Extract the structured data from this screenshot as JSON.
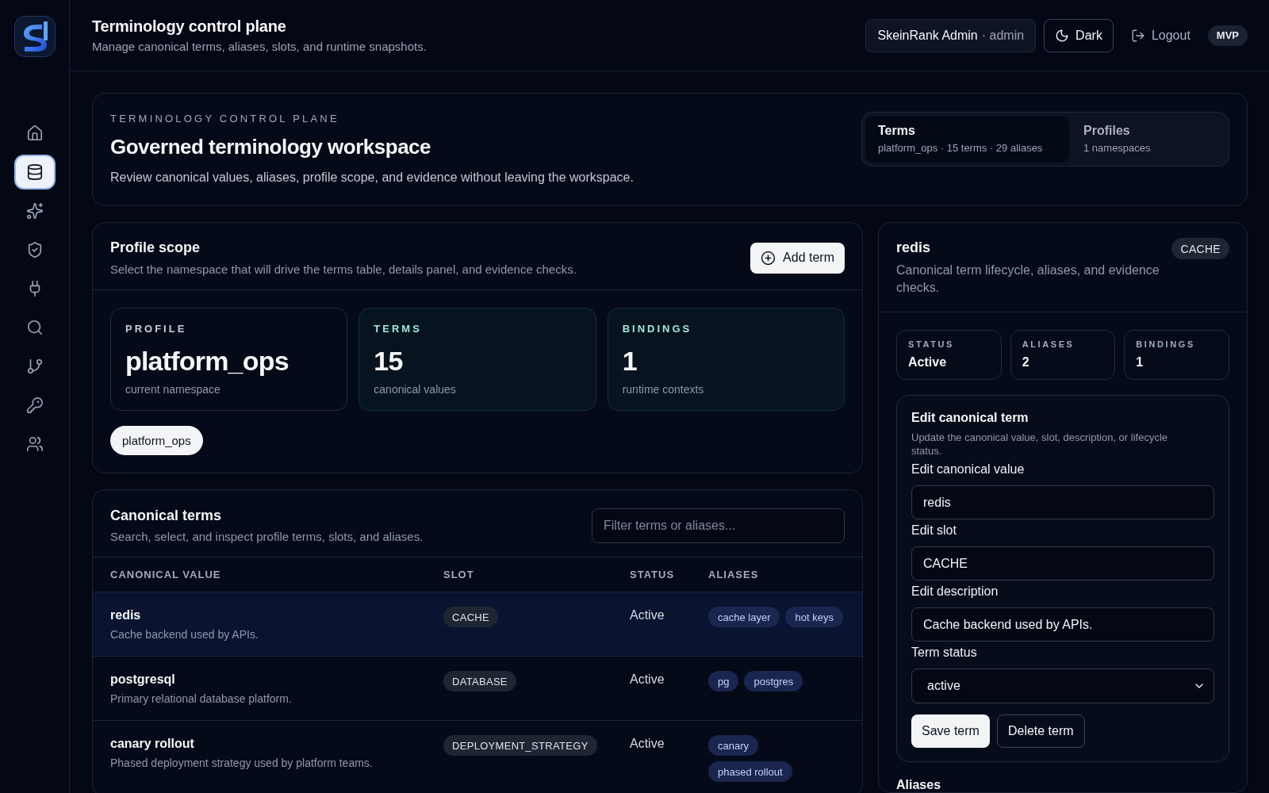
{
  "sidebar": {
    "nav": [
      {
        "kind": "home",
        "selected": false
      },
      {
        "kind": "database",
        "selected": true
      },
      {
        "kind": "sparkles",
        "selected": false
      },
      {
        "kind": "shield",
        "selected": false
      },
      {
        "kind": "plug",
        "selected": false
      },
      {
        "kind": "search",
        "selected": false
      },
      {
        "kind": "branch",
        "selected": false
      },
      {
        "kind": "key",
        "selected": false
      },
      {
        "kind": "users",
        "selected": false
      }
    ]
  },
  "header": {
    "title": "Terminology control plane",
    "subtitle": "Manage canonical terms, aliases, slots, and runtime snapshots.",
    "user": {
      "name": "SkeinRank Admin",
      "role": "· admin"
    },
    "theme_button": "Dark",
    "logout_button": "Logout",
    "badge": "MVP"
  },
  "hero": {
    "eyebrow": "TERMINOLOGY CONTROL PLANE",
    "title": "Governed terminology workspace",
    "description": "Review canonical values, aliases, profile scope, and evidence without leaving the workspace.",
    "tabs": [
      {
        "label": "Terms",
        "detail": "platform_ops · 15 terms · 29 aliases",
        "selected": true
      },
      {
        "label": "Profiles",
        "detail": "1 namespaces",
        "selected": false
      }
    ]
  },
  "profile_scope": {
    "title": "Profile scope",
    "description": "Select the namespace that will drive the terms table, details panel, and evidence checks.",
    "add_button": "Add term",
    "stats": [
      {
        "label": "PROFILE",
        "value": "platform_ops",
        "caption": "current namespace",
        "highlighted": false
      },
      {
        "label": "TERMS",
        "value": "15",
        "caption": "canonical values",
        "highlighted": true
      },
      {
        "label": "BINDINGS",
        "value": "1",
        "caption": "runtime contexts",
        "highlighted": true
      }
    ],
    "profiles": [
      {
        "label": "platform_ops",
        "selected": true
      }
    ]
  },
  "terms_table": {
    "title": "Canonical terms",
    "description": "Search, select, and inspect profile terms, slots, and aliases.",
    "filter": {
      "placeholder": "Filter terms or aliases..."
    },
    "columns": [
      "CANONICAL VALUE",
      "SLOT",
      "STATUS",
      "ALIASES"
    ],
    "rows": [
      {
        "value": "redis",
        "description": "Cache backend used by APIs.",
        "slot": "CACHE",
        "status": "Active",
        "aliases": [
          "cache layer",
          "hot keys"
        ],
        "selected": true
      },
      {
        "value": "postgresql",
        "description": "Primary relational database platform.",
        "slot": "DATABASE",
        "status": "Active",
        "aliases": [
          "pg",
          "postgres"
        ],
        "selected": false
      },
      {
        "value": "canary rollout",
        "description": "Phased deployment strategy used by platform teams.",
        "slot": "DEPLOYMENT_STRATEGY",
        "status": "Active",
        "aliases": [
          "canary",
          "phased rollout"
        ],
        "selected": false
      }
    ]
  },
  "term_detail": {
    "title": "redis",
    "slot": "CACHE",
    "description": "Canonical term lifecycle, aliases, and evidence checks.",
    "stats": [
      {
        "label": "STATUS",
        "value": "Active"
      },
      {
        "label": "ALIASES",
        "value": "2"
      },
      {
        "label": "BINDINGS",
        "value": "1"
      }
    ],
    "edit_form": {
      "title": "Edit canonical term",
      "description": "Update the canonical value, slot, description, or lifecycle status.",
      "fields": [
        {
          "kind": "text",
          "label": "Edit canonical value",
          "value": "redis"
        },
        {
          "kind": "text",
          "label": "Edit slot",
          "value": "CACHE"
        },
        {
          "kind": "text",
          "label": "Edit description",
          "value": "Cache backend used by APIs."
        },
        {
          "kind": "select",
          "label": "Term status",
          "value": "active"
        }
      ],
      "save_button": "Save term",
      "delete_button": "Delete term"
    },
    "aliases_heading": "Aliases"
  }
}
